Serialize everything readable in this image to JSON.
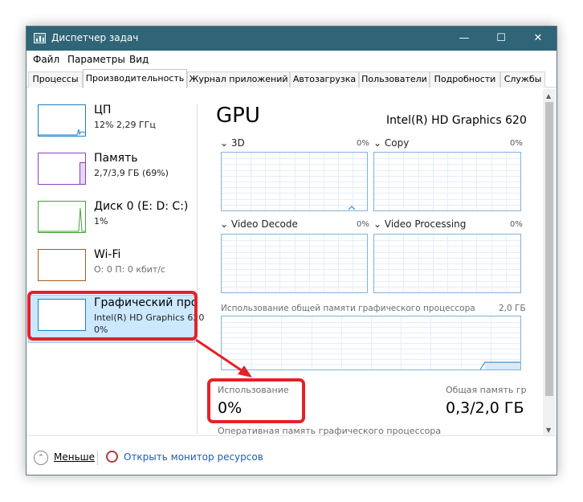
{
  "window": {
    "title": "Диспетчер задач",
    "controls": {
      "minimize": "—",
      "maximize": "☐",
      "close": "✕"
    }
  },
  "menu": [
    "Файл",
    "Параметры",
    "Вид"
  ],
  "tabs": [
    "Процессы",
    "Производительность",
    "Журнал приложений",
    "Автозагрузка",
    "Пользователи",
    "Подробности",
    "Службы"
  ],
  "sidebar": {
    "items": [
      {
        "title": "ЦП",
        "sub": "12% 2,29 ГГц"
      },
      {
        "title": "Память",
        "sub": "2,7/3,9 ГБ (69%)"
      },
      {
        "title": "Диск 0 (E: D: C:)",
        "sub": "1%"
      },
      {
        "title": "Wi-Fi",
        "sub": "О: 0 П: 0 кбит/с"
      },
      {
        "title": "Графический про",
        "sub": "Intel(R) HD Graphics 620",
        "sub2": "0%"
      }
    ]
  },
  "main": {
    "title": "GPU",
    "model": "Intel(R) HD Graphics 620",
    "engines": [
      {
        "label": "3D",
        "value": "0%"
      },
      {
        "label": "Copy",
        "value": "0%"
      },
      {
        "label": "Video Decode",
        "value": "0%"
      },
      {
        "label": "Video Processing",
        "value": "0%"
      }
    ],
    "chevron": "⌄",
    "shared_memory": {
      "label": "Использование общей памяти графического процессора",
      "max": "2,0 ГБ"
    },
    "usage": {
      "label": "Использование",
      "value": "0%"
    },
    "total_memory": {
      "label": "Общая память гр",
      "value": "0,3/2,0 ГБ"
    },
    "dedicated_label": "Оперативная память графического процессора"
  },
  "footer": {
    "less": "Меньше",
    "less_icon": "⌃",
    "monitor": "Открыть монитор ресурсов"
  },
  "colors": {
    "titlebar": "#2f6576",
    "cpu": "#1a7fcb",
    "memory": "#8c3fbf",
    "disk": "#4aa23c",
    "wifi": "#a85a1e",
    "gpu": "#1a7fcb",
    "highlight": "#cce8ff",
    "annotation": "#e52129"
  }
}
